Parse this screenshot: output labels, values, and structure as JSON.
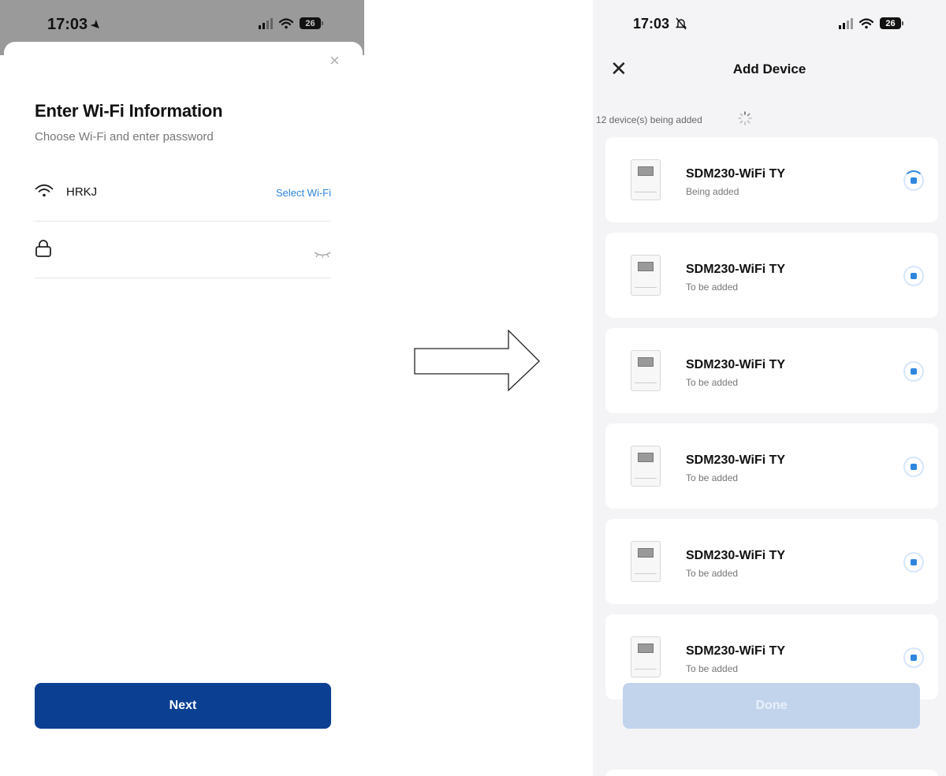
{
  "left_screen": {
    "status_bar": {
      "time": "17:03",
      "battery": "26"
    },
    "title": "Enter Wi-Fi Information",
    "subtitle": "Choose Wi-Fi and enter password",
    "wifi": {
      "ssid": "HRKJ",
      "select_label": "Select Wi-Fi"
    },
    "password": {
      "value": ""
    },
    "next_label": "Next",
    "close_symbol": "×"
  },
  "right_screen": {
    "status_bar": {
      "time": "17:03",
      "battery": "26"
    },
    "title": "Add Device",
    "close_symbol": "✕",
    "count_text": "12 device(s) being added",
    "devices": [
      {
        "name": "SDM230-WiFi TY",
        "status": "Being added"
      },
      {
        "name": "SDM230-WiFi TY",
        "status": "To be added"
      },
      {
        "name": "SDM230-WiFi TY",
        "status": "To be added"
      },
      {
        "name": "SDM230-WiFi TY",
        "status": "To be added"
      },
      {
        "name": "SDM230-WiFi TY",
        "status": "To be added"
      },
      {
        "name": "SDM230-WiFi TY",
        "status": "To be added"
      }
    ],
    "done_label": "Done"
  },
  "colors": {
    "primary": "#0b3f91",
    "link": "#2e86de",
    "done_disabled": "#c2d4ec",
    "status_bar_grey": "#9a9a9a"
  },
  "icons": [
    "location-arrow-icon",
    "signal-icon",
    "wifi-icon",
    "battery-icon",
    "close-icon",
    "lock-icon",
    "eye-closed-icon",
    "bell-off-icon",
    "spinner-icon",
    "meter-device-icon",
    "progress-indicator-icon",
    "right-arrow-icon"
  ]
}
